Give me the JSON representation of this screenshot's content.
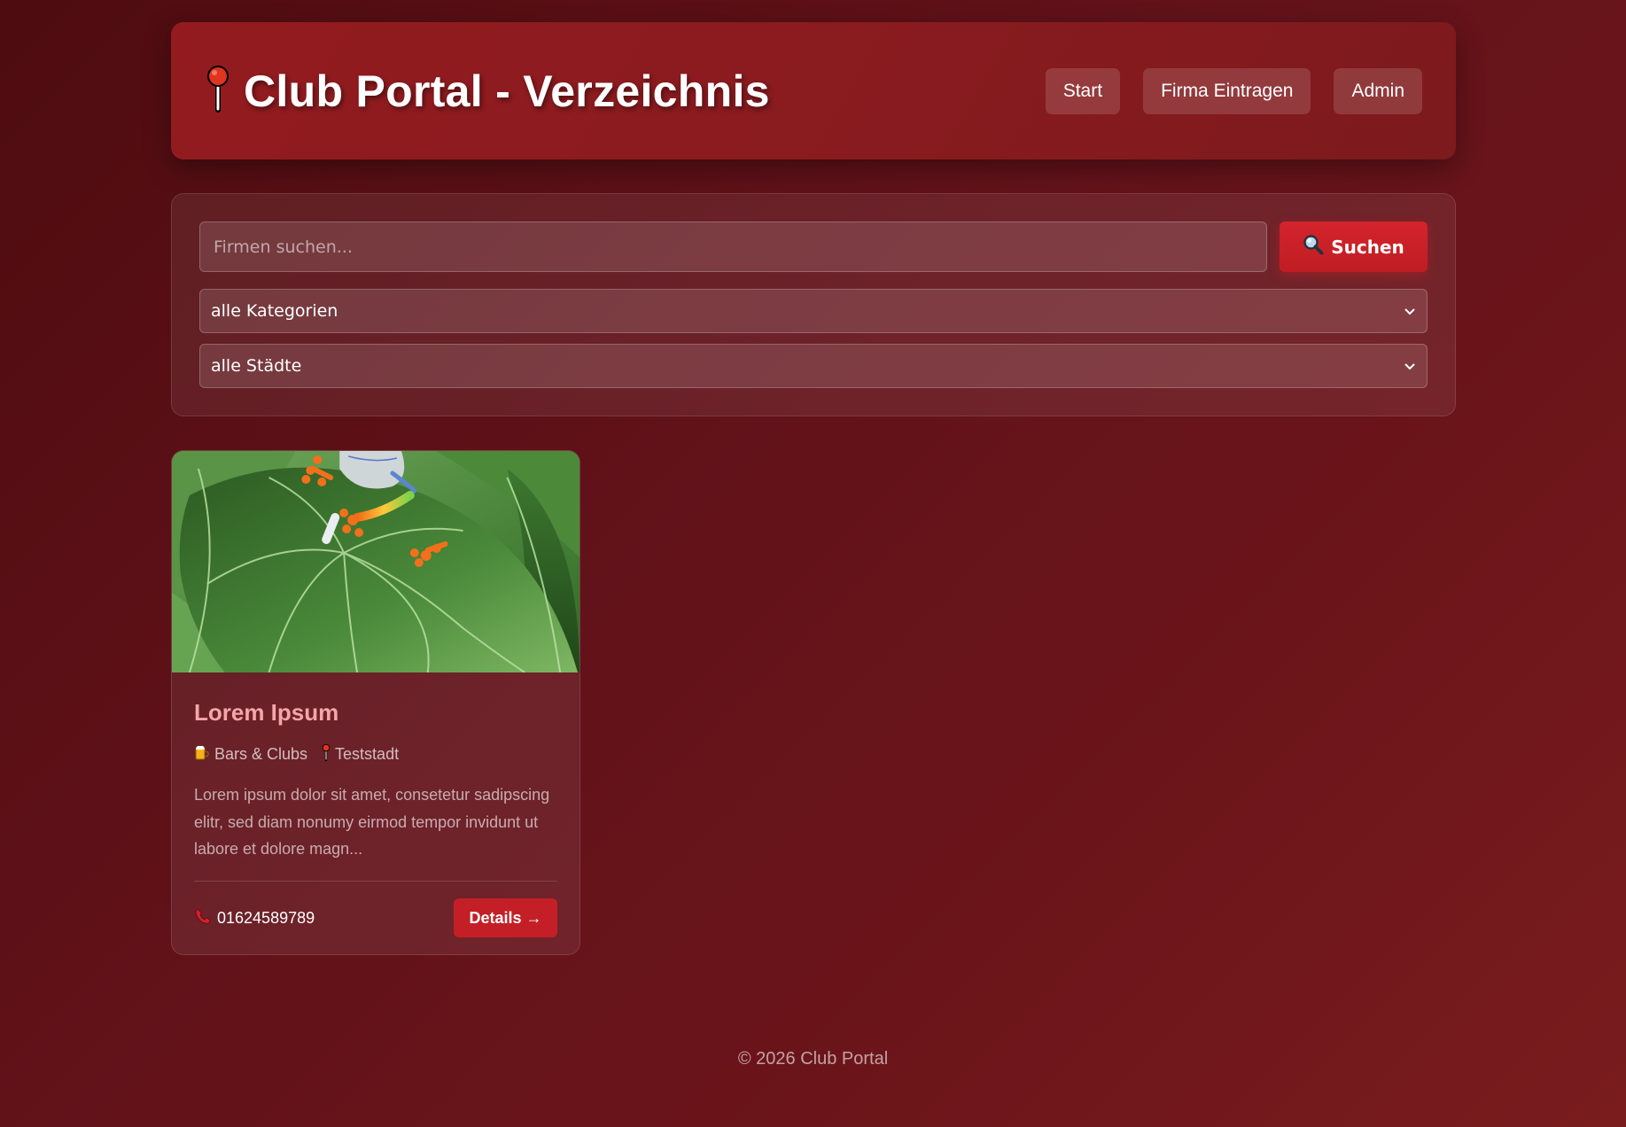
{
  "header": {
    "title": "Club Portal - Verzeichnis",
    "logo_icon": "pushpin-icon",
    "nav": [
      {
        "label": "Start"
      },
      {
        "label": "Firma Eintragen"
      },
      {
        "label": "Admin"
      }
    ]
  },
  "search": {
    "placeholder": "Firmen suchen...",
    "value": "",
    "button_label": "Suchen",
    "button_icon": "magnifier-icon",
    "category_select": "alle Kategorien",
    "city_select": "alle Städte"
  },
  "listings": [
    {
      "title": "Lorem Ipsum",
      "category": "Bars & Clubs",
      "category_icon": "beer-mug-icon",
      "city": "Teststadt",
      "city_icon": "pushpin-icon",
      "description": "Lorem ipsum dolor sit amet, consetetur sadipscing elitr, sed diam nonumy eirmod tempor invidunt ut labore et dolore magn...",
      "phone": "01624589789",
      "phone_icon": "telephone-icon",
      "details_label": "Details →"
    }
  ],
  "footer": {
    "copyright": "© 2026 Club Portal"
  },
  "colors": {
    "accent": "#c41f27",
    "header_bg": "#8a1b1f",
    "title_pink": "#f4a6a8"
  }
}
